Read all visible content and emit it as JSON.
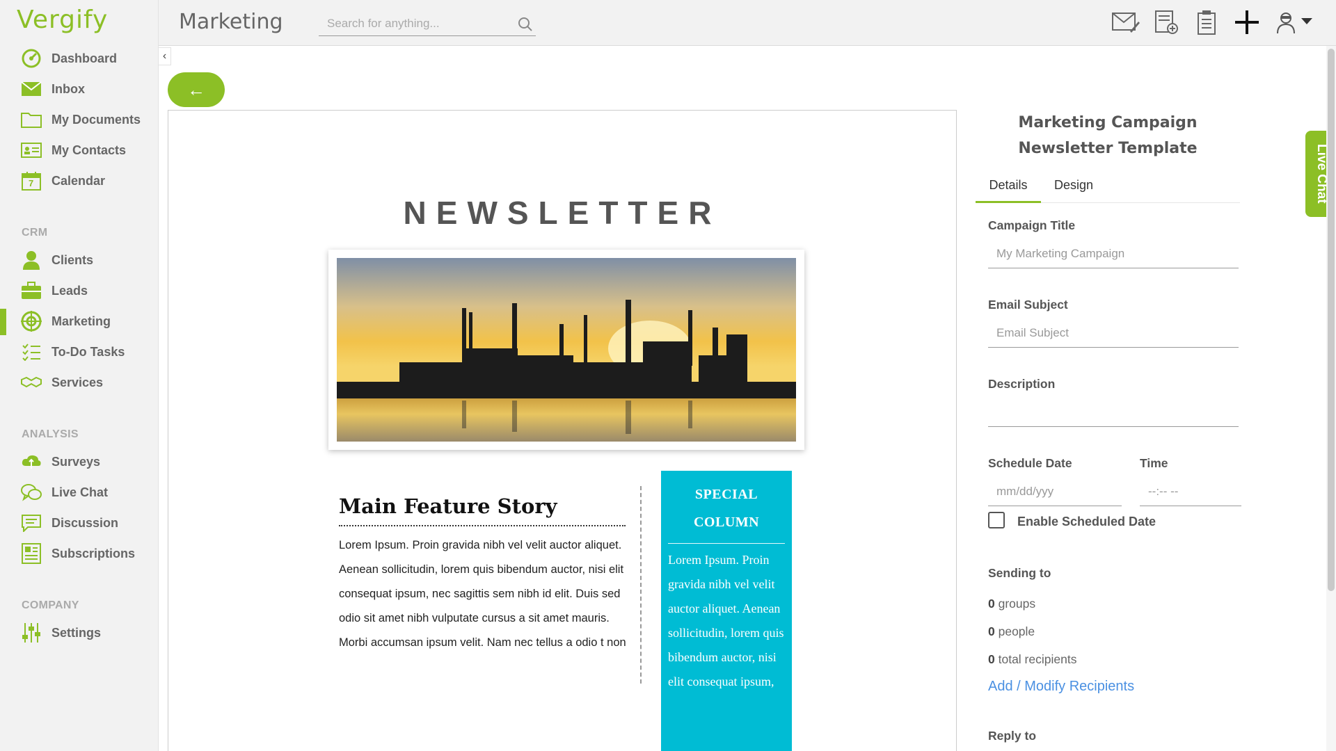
{
  "app": {
    "logo": "Vergify"
  },
  "header": {
    "page_title": "Marketing",
    "search_placeholder": "Search for anything..."
  },
  "sidebar": {
    "main_items": [
      {
        "label": "Dashboard",
        "icon": "dashboard-icon"
      },
      {
        "label": "Inbox",
        "icon": "envelope-icon"
      },
      {
        "label": "My Documents",
        "icon": "folder-icon"
      },
      {
        "label": "My Contacts",
        "icon": "contact-card-icon"
      },
      {
        "label": "Calendar",
        "icon": "calendar-icon",
        "day": "7"
      }
    ],
    "crm_label": "CRM",
    "crm_items": [
      {
        "label": "Clients",
        "icon": "person-icon"
      },
      {
        "label": "Leads",
        "icon": "briefcase-icon"
      },
      {
        "label": "Marketing",
        "icon": "target-icon",
        "active": true
      },
      {
        "label": "To-Do Tasks",
        "icon": "checklist-icon"
      },
      {
        "label": "Services",
        "icon": "handshake-icon"
      }
    ],
    "analysis_label": "ANALYSIS",
    "analysis_items": [
      {
        "label": "Surveys",
        "icon": "survey-cloud-icon"
      },
      {
        "label": "Live Chat",
        "icon": "chat-bubbles-icon"
      },
      {
        "label": "Discussion",
        "icon": "discussion-icon"
      },
      {
        "label": "Subscriptions",
        "icon": "newspaper-icon"
      }
    ],
    "company_label": "COMPANY",
    "company_items": [
      {
        "label": "Settings",
        "icon": "sliders-icon"
      }
    ]
  },
  "newsletter": {
    "heading": "NEWSLETTER",
    "story_title": "Main Feature Story",
    "story_body": "Lorem Ipsum. Proin gravida nibh vel velit auctor aliquet. Aenean sollicitudin, lorem quis bibendum auctor, nisi elit consequat ipsum, nec sagittis sem nibh id elit. Duis sed odio sit amet nibh vulputate cursus a sit amet mauris. Morbi accumsan ipsum velit. Nam nec tellus a odio t non",
    "special_title": "SPECIAL COLUMN",
    "special_body": "Lorem Ipsum. Proin gravida nibh vel velit auctor aliquet. Aenean sollicitudin, lorem quis bibendum auctor, nisi elit consequat ipsum,"
  },
  "panel": {
    "title": "Marketing Campaign Newsletter Template",
    "tabs": [
      "Details",
      "Design"
    ],
    "campaign_title_label": "Campaign Title",
    "campaign_title_placeholder": "My Marketing Campaign",
    "email_subject_label": "Email Subject",
    "email_subject_placeholder": "Email Subject",
    "description_label": "Description",
    "schedule_date_label": "Schedule Date",
    "schedule_date_placeholder": "mm/dd/yyy",
    "time_label": "Time",
    "time_placeholder": "--:-- --",
    "enable_schedule_label": "Enable Scheduled Date",
    "sending_to_label": "Sending to",
    "groups_count": "0",
    "groups_label": "groups",
    "people_count": "0",
    "people_label": "people",
    "recipients_count": "0",
    "recipients_label": "total recipients",
    "modify_link": "Add / Modify Recipients",
    "reply_to_label": "Reply to"
  },
  "live_chat_tab": "Live Chat",
  "colors": {
    "accent": "#8cbf26",
    "special_column": "#00bcd4",
    "link": "#4a90e2"
  }
}
